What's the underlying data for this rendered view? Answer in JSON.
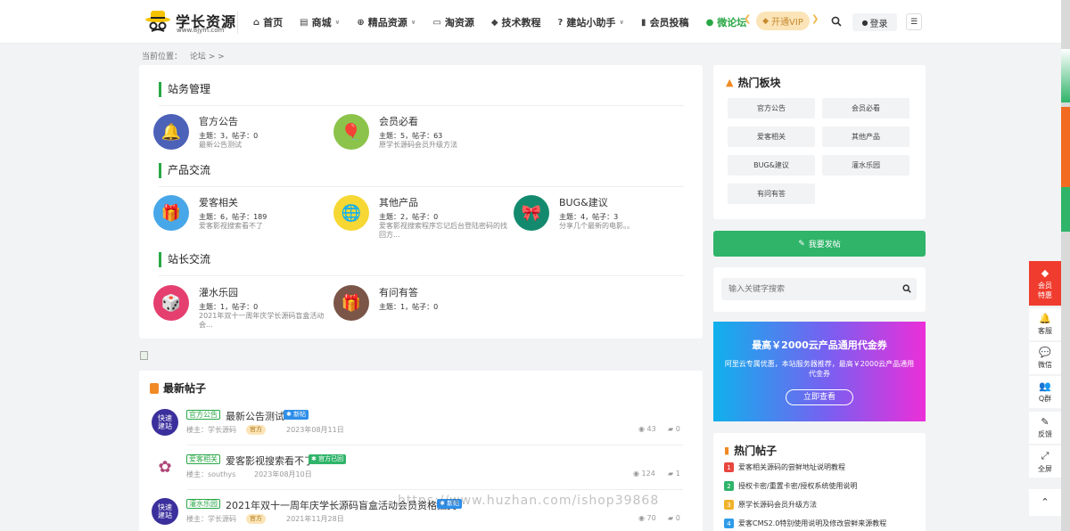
{
  "header": {
    "logo_title": "学长资源",
    "logo_sub": "www.8jym.com",
    "nav": [
      {
        "icon": "home-icon",
        "glyph": "⌂",
        "label": "首页",
        "dropdown": false
      },
      {
        "icon": "shop-icon",
        "glyph": "▤",
        "label": "商城",
        "dropdown": true
      },
      {
        "icon": "globe-icon",
        "glyph": "⊕",
        "label": "精品资源",
        "dropdown": true
      },
      {
        "icon": "tray-icon",
        "glyph": "▭",
        "label": "淘资源",
        "dropdown": false
      },
      {
        "icon": "graduation-icon",
        "glyph": "◆",
        "label": "技术教程",
        "dropdown": false
      },
      {
        "icon": "help-icon",
        "glyph": "?",
        "label": "建站小助手",
        "dropdown": true
      },
      {
        "icon": "book-icon",
        "glyph": "▮",
        "label": "会员投稿",
        "dropdown": false
      },
      {
        "icon": "chat-icon",
        "glyph": "●",
        "label": "微论坛",
        "dropdown": false
      }
    ],
    "vip_label": "开通VIP",
    "login_label": "登录"
  },
  "breadcrumb": {
    "prefix": "当前位置：",
    "item": "论坛",
    "sep": " > >"
  },
  "sections": [
    {
      "title": "站务管理",
      "forums": [
        {
          "name": "官方公告",
          "stats": "主题：3，帖子：0",
          "desc": "最新公告测试",
          "color": "#4c62b8",
          "glyph": "🔔"
        },
        {
          "name": "会员必看",
          "stats": "主题：5，帖子：63",
          "desc": "原学长源码会员升级方法",
          "color": "#8cc34a",
          "glyph": "🎈"
        }
      ]
    },
    {
      "title": "产品交流",
      "forums": [
        {
          "name": "爱客相关",
          "stats": "主题：6，帖子：189",
          "desc": "爱客影视搜索看不了",
          "color": "#48a7e8",
          "glyph": "🎁"
        },
        {
          "name": "其他产品",
          "stats": "主题：2，帖子：0",
          "desc": "爱客影视搜索程序忘记后台登陆密码的找回方...",
          "color": "#f6d734",
          "glyph": "🌐"
        },
        {
          "name": "BUG&建议",
          "stats": "主题：4，帖子：3",
          "desc": "分享几个最新的电影。。",
          "color": "#138a6e",
          "glyph": "🎀"
        }
      ]
    },
    {
      "title": "站长交流",
      "forums": [
        {
          "name": "灌水乐园",
          "stats": "主题：1，帖子：0",
          "desc": "2021年双十一周年庆学长源码盲盒活动会...",
          "color": "#e43f6f",
          "glyph": "🎲"
        },
        {
          "name": "有问有答",
          "stats": "主题：1，帖子：0",
          "desc": "",
          "color": "#7a5548",
          "glyph": "🎁"
        }
      ]
    }
  ],
  "latest": {
    "title": "最新帖子",
    "posts": [
      {
        "avatar": "快速\n建站",
        "avatar_color": "#3a2f9c",
        "tag": "官方公告",
        "title": "最新公告测试",
        "badge": "新帖",
        "badge_color": "#2e8ee8",
        "author": "楼主：学长源码",
        "official": "官方",
        "date": "2023年08月11日",
        "views": "43",
        "comments": "0"
      },
      {
        "avatar": "✿",
        "avatar_color": "#ffffff",
        "tag": "爱客相关",
        "title": "爱客影视搜索看不了",
        "badge": "官方已回",
        "badge_color": "#2fb469",
        "author": "楼主：southys",
        "official": "",
        "date": "2023年08月10日",
        "views": "124",
        "comments": "1"
      },
      {
        "avatar": "快速\n建站",
        "avatar_color": "#3a2f9c",
        "tag": "灌水乐园",
        "title": "2021年双十一周年庆学长源码盲盒活动会员资格抽奖",
        "badge": "新帖",
        "badge_color": "#2e8ee8",
        "author": "楼主：学长源码",
        "official": "官方",
        "date": "2021年11月28日",
        "views": "70",
        "comments": "0"
      }
    ]
  },
  "sidebar": {
    "hot_boards_title": "热门板块",
    "hot_boards": [
      "官方公告",
      "会员必看",
      "爱客相关",
      "其他产品",
      "BUG&建议",
      "灌水乐园",
      "有问有答"
    ],
    "post_button": "我要发帖",
    "search_placeholder": "输入关键字搜索",
    "ad_title": "最高￥2000云产品通用代金券",
    "ad_desc": "阿里云专属优惠，本站服务器推荐，最高￥2000云产品通用代金券",
    "ad_button": "立即查看",
    "hot_posts_title": "热门帖子",
    "hot_posts": [
      {
        "n": "1",
        "color": "#e8463f",
        "title": "爱客相关源码的尝鲜地址说明教程"
      },
      {
        "n": "2",
        "color": "#2fb469",
        "title": "授权卡密/重置卡密/授权系统使用说明"
      },
      {
        "n": "3",
        "color": "#f0b22a",
        "title": "原学长源码会员升级方法"
      },
      {
        "n": "4",
        "color": "#2e9be8",
        "title": "爱客CMS2.0特别使用说明及修改尝鲜来源教程"
      }
    ]
  },
  "float_bar": [
    {
      "name": "vip",
      "icon": "diamond-icon",
      "glyph": "◆",
      "label": "会员\n特惠"
    },
    {
      "name": "service",
      "icon": "bell-icon",
      "glyph": "🔔",
      "label": "客服"
    },
    {
      "name": "wechat",
      "icon": "wechat-icon",
      "glyph": "💬",
      "label": "微信"
    },
    {
      "name": "qq",
      "icon": "qq-icon",
      "glyph": "👥",
      "label": "Q群"
    },
    {
      "name": "feedback",
      "icon": "edit-icon",
      "glyph": "✎",
      "label": "反馈"
    },
    {
      "name": "fullscreen",
      "icon": "expand-icon",
      "glyph": "⤢",
      "label": "全屏"
    },
    {
      "name": "top",
      "icon": "chevron-up-icon",
      "glyph": "⌃",
      "label": ""
    }
  ],
  "watermark": "https://www.huzhan.com/ishop39868"
}
